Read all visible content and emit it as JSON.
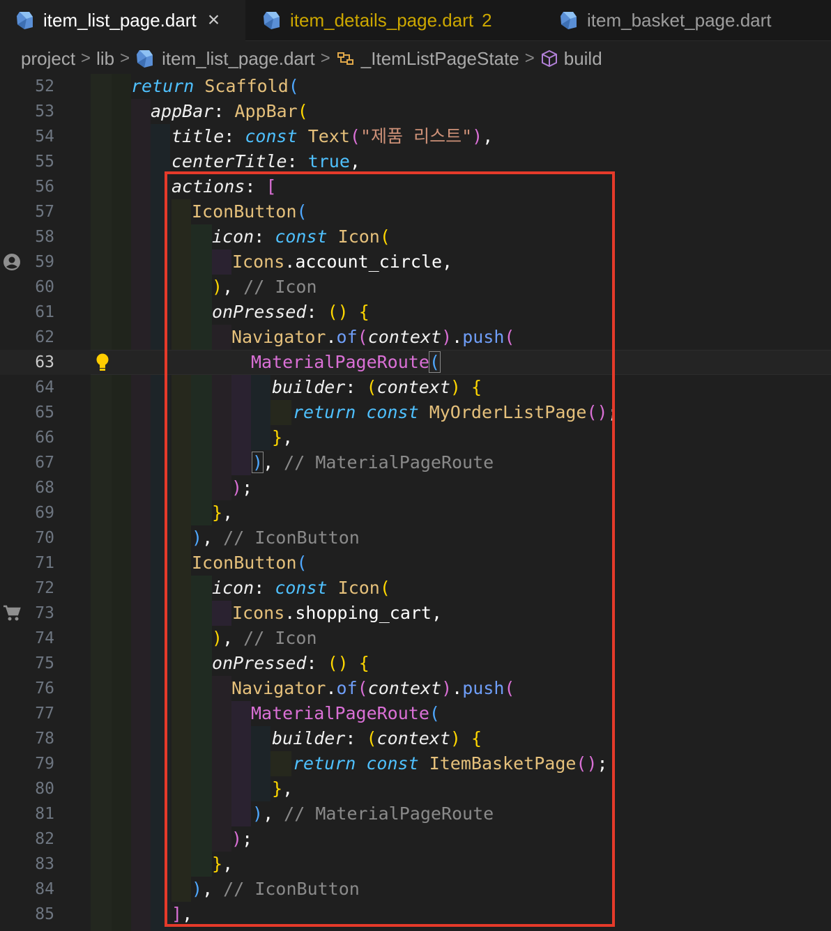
{
  "tabs": [
    {
      "label": "item_list_page.dart",
      "active": true,
      "close": "×"
    },
    {
      "label": "item_details_page.dart",
      "badge": "2"
    },
    {
      "label": "item_basket_page.dart"
    }
  ],
  "breadcrumb": {
    "items": [
      "project",
      "lib",
      "item_list_page.dart",
      "_ItemListPageState",
      "build"
    ],
    "separator": ">"
  },
  "editor": {
    "current_line": "63",
    "lines": [
      {
        "n": "52"
      },
      {
        "n": "53"
      },
      {
        "n": "54"
      },
      {
        "n": "55"
      },
      {
        "n": "56"
      },
      {
        "n": "57"
      },
      {
        "n": "58"
      },
      {
        "n": "59"
      },
      {
        "n": "60"
      },
      {
        "n": "61"
      },
      {
        "n": "62"
      },
      {
        "n": "63"
      },
      {
        "n": "64"
      },
      {
        "n": "65"
      },
      {
        "n": "66"
      },
      {
        "n": "67"
      },
      {
        "n": "68"
      },
      {
        "n": "69"
      },
      {
        "n": "70"
      },
      {
        "n": "71"
      },
      {
        "n": "72"
      },
      {
        "n": "73"
      },
      {
        "n": "74"
      },
      {
        "n": "75"
      },
      {
        "n": "76"
      },
      {
        "n": "77"
      },
      {
        "n": "78"
      },
      {
        "n": "79"
      },
      {
        "n": "80"
      },
      {
        "n": "81"
      },
      {
        "n": "82"
      },
      {
        "n": "83"
      },
      {
        "n": "84"
      },
      {
        "n": "85"
      }
    ],
    "tokens": {
      "l52": [
        "return",
        " ",
        "Scaffold",
        "("
      ],
      "l53": [
        "appBar",
        ": ",
        "AppBar",
        "("
      ],
      "l54": [
        "title",
        ": ",
        "const",
        " ",
        "Text",
        "(",
        "\"제품 리스트\"",
        ")",
        ","
      ],
      "l55": [
        "centerTitle",
        ": ",
        "true",
        ","
      ],
      "l56": [
        "actions",
        ": ",
        "["
      ],
      "l57": [
        "IconButton",
        "("
      ],
      "l58": [
        "icon",
        ": ",
        "const",
        " ",
        "Icon",
        "("
      ],
      "l59": [
        "Icons",
        ".account_circle,"
      ],
      "l60": [
        ")",
        ", ",
        "// Icon"
      ],
      "l61": [
        "onPressed",
        ": ",
        "()",
        " ",
        "{"
      ],
      "l62": [
        "Navigator",
        ".",
        "of",
        "(",
        "context",
        ")",
        ".",
        "push",
        "("
      ],
      "l63": [
        "MaterialPageRoute",
        "("
      ],
      "l64": [
        "builder",
        ": ",
        "(",
        "context",
        ")",
        " ",
        "{"
      ],
      "l65": [
        "return",
        " ",
        "const",
        " ",
        "MyOrderListPage",
        "()",
        ";"
      ],
      "l66": [
        "}",
        ","
      ],
      "l67": [
        ")",
        ", ",
        "// MaterialPageRoute"
      ],
      "l68": [
        ")",
        ";"
      ],
      "l69": [
        "}",
        ","
      ],
      "l70": [
        ")",
        ", ",
        "// IconButton"
      ],
      "l71": [
        "IconButton",
        "("
      ],
      "l72": [
        "icon",
        ": ",
        "const",
        " ",
        "Icon",
        "("
      ],
      "l73": [
        "Icons",
        ".shopping_cart,"
      ],
      "l74": [
        ")",
        ", ",
        "// Icon"
      ],
      "l75": [
        "onPressed",
        ": ",
        "()",
        " ",
        "{"
      ],
      "l76": [
        "Navigator",
        ".",
        "of",
        "(",
        "context",
        ")",
        ".",
        "push",
        "("
      ],
      "l77": [
        "MaterialPageRoute",
        "("
      ],
      "l78": [
        "builder",
        ": ",
        "(",
        "context",
        ")",
        " ",
        "{"
      ],
      "l79": [
        "return",
        " ",
        "const",
        " ",
        "ItemBasketPage",
        "()",
        ";"
      ],
      "l80": [
        "}",
        ","
      ],
      "l81": [
        ")",
        ", ",
        "// MaterialPageRoute"
      ],
      "l82": [
        ")",
        ";"
      ],
      "l83": [
        "}",
        ","
      ],
      "l84": [
        ")",
        ", ",
        "// IconButton"
      ],
      "l85": [
        "]",
        ","
      ]
    }
  },
  "colors": {
    "highlight_box": "#e53a2a",
    "keyword": "#4fc1ff",
    "class": "#e5c07b",
    "comment": "#8a8a8a",
    "bracket_gold": "#ffd700",
    "bracket_purple": "#da70d6",
    "bracket_blue": "#4fa8ff"
  }
}
